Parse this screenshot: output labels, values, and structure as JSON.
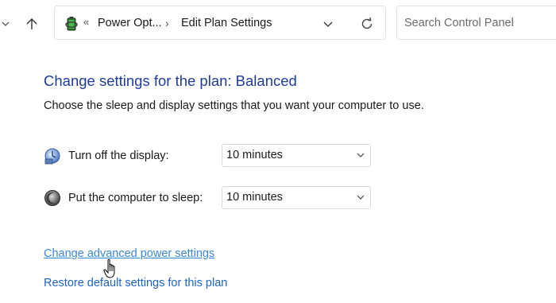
{
  "address_bar": {
    "crumb_prefix": "«",
    "crumb_parent": "Power Opt...",
    "crumb_separator": "›",
    "crumb_current": "Edit Plan Settings",
    "icon": "power-options-battery-icon"
  },
  "search": {
    "placeholder": "Search Control Panel",
    "value": ""
  },
  "page": {
    "title": "Change settings for the plan: Balanced",
    "description": "Choose the sleep and display settings that you want your computer to use."
  },
  "settings": [
    {
      "label": "Turn off the display:",
      "value": "10 minutes",
      "icon": "display-icon"
    },
    {
      "label": "Put the computer to sleep:",
      "value": "10 minutes",
      "icon": "sleep-moon-icon"
    }
  ],
  "links": {
    "advanced": "Change advanced power settings",
    "restore": "Restore default settings for this plan"
  },
  "colors": {
    "title": "#1e3c96",
    "link": "#1e64c8",
    "link_hover": "#3c88d8"
  }
}
